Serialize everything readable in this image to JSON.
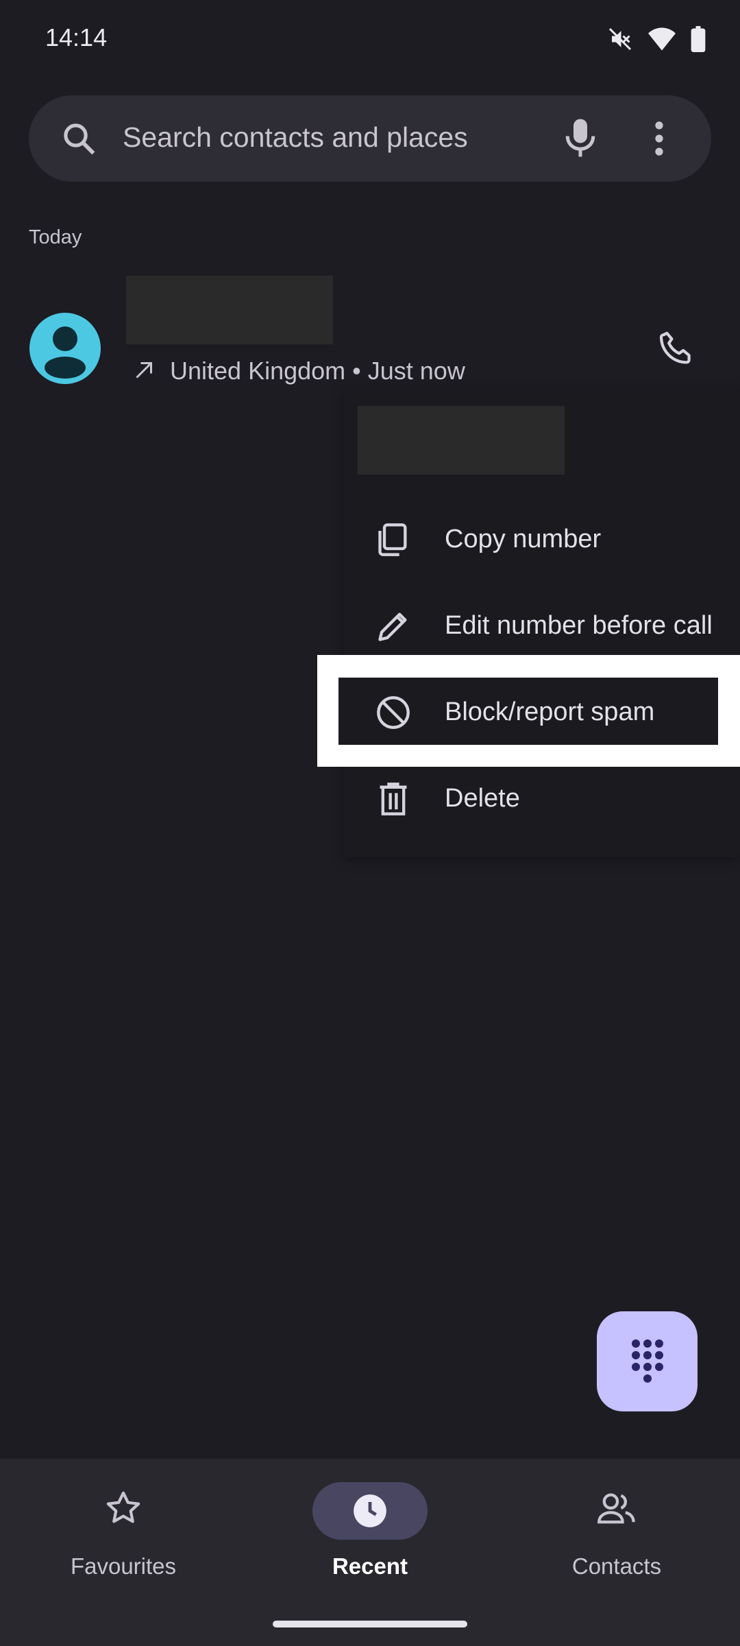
{
  "status_bar": {
    "time": "14:14",
    "icons": [
      "mute-icon",
      "wifi-icon",
      "battery-icon"
    ]
  },
  "search": {
    "placeholder": "Search contacts and places"
  },
  "call_log": {
    "section_title": "Today",
    "items": [
      {
        "meta": "United Kingdom • Just now",
        "direction": "outgoing",
        "avatar_color": "#4cc8e3"
      }
    ]
  },
  "context_menu": {
    "items": [
      {
        "label": "Copy number",
        "icon": "copy-icon"
      },
      {
        "label": "Edit number before call",
        "icon": "pencil-icon"
      },
      {
        "label": "Block/report spam",
        "icon": "block-icon"
      },
      {
        "label": "Delete",
        "icon": "trash-icon"
      }
    ]
  },
  "bottom_nav": {
    "items": [
      {
        "label": "Favourites",
        "icon": "star-icon"
      },
      {
        "label": "Recent",
        "icon": "clock-icon",
        "active": true
      },
      {
        "label": "Contacts",
        "icon": "people-icon"
      }
    ]
  },
  "colors": {
    "background": "#1d1c22",
    "accent": "#c6c1ff",
    "avatar": "#4cc8e3",
    "highlight": "#ffffff"
  }
}
